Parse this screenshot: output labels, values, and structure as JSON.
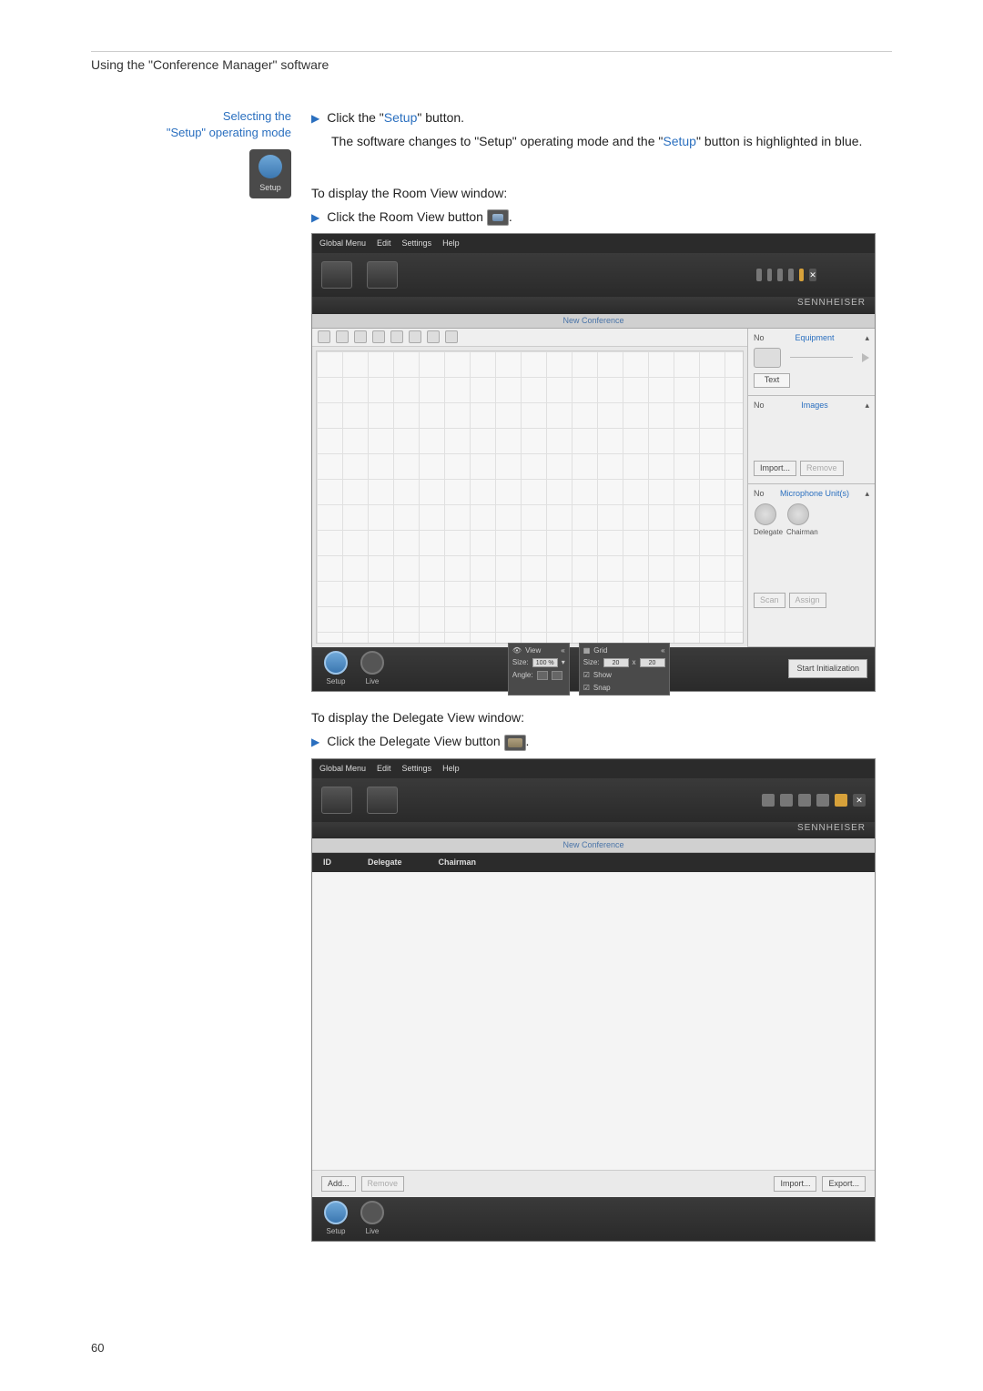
{
  "page": {
    "number": "60",
    "running_head": "Using the \"Conference Manager\" software"
  },
  "sidecol": {
    "title_l1": "Selecting the",
    "title_l2": "\"Setup\" operating mode",
    "icon_label": "Setup"
  },
  "body": {
    "p1_a": "Click the \"",
    "p1_setup": "Setup",
    "p1_b": "\" button.",
    "p2_a": "The software changes to \"Setup\" operating mode and the \"",
    "p2_setup": "Setup",
    "p2_b": "\" button is highlighted in blue.",
    "roomview_intro": "To display the Room View window:",
    "roomview_click": "Click the Room View button",
    "dot1": ".",
    "delegateview_intro": "To display the Delegate View window:",
    "delegateview_click": "Click the Delegate View button",
    "dot2": "."
  },
  "app_common": {
    "menu": {
      "global": "Global Menu",
      "edit": "Edit",
      "settings": "Settings",
      "help": "Help"
    },
    "brand": "SENNHEISER",
    "tab": "New Conference",
    "footer_modes": {
      "setup": "Setup",
      "live": "Live"
    }
  },
  "app1": {
    "right": {
      "equip_no": "No",
      "equip_title": "Equipment",
      "text_btn": "Text",
      "images_no": "No",
      "images_title": "Images",
      "import": "Import...",
      "remove": "Remove",
      "mic_no": "No",
      "mic_title": "Microphone Unit(s)",
      "mic_delegate": "Delegate",
      "mic_chairman": "Chairman",
      "scan": "Scan",
      "assign": "Assign"
    },
    "footer": {
      "view_label": "View",
      "grid_label": "Grid",
      "size": "Size:",
      "size_val": "100 %",
      "angle": "Angle:",
      "grid_size": "Size:",
      "grid_w": "20",
      "grid_x": "x",
      "grid_h": "20",
      "show": "Show",
      "snap": "Snap",
      "start_init": "Start Initialization"
    }
  },
  "app2": {
    "cols": {
      "id": "ID",
      "delegate": "Delegate",
      "chairman": "Chairman"
    },
    "btns": {
      "add": "Add...",
      "remove": "Remove",
      "import": "Import...",
      "export": "Export..."
    }
  }
}
